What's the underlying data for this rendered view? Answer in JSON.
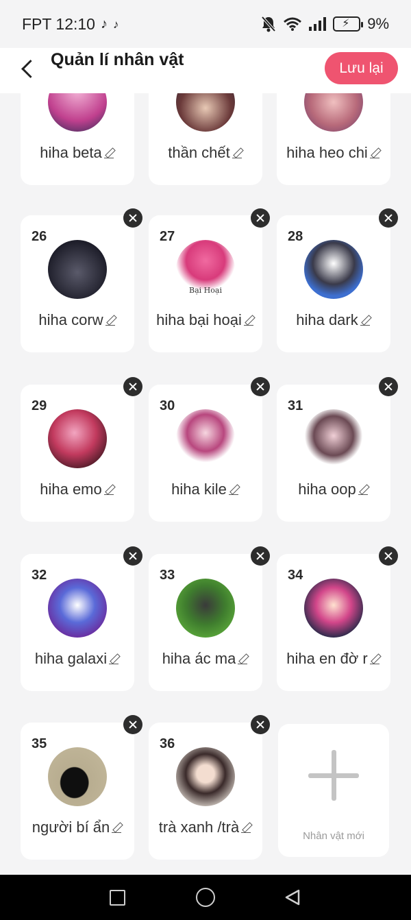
{
  "status_bar": {
    "carrier_time": "FPT 12:10",
    "battery": "9%",
    "icons": [
      "tiktok-icon",
      "tiktok-icon",
      "mute-bell-icon",
      "wifi-icon",
      "signal-icon",
      "battery-charging-icon"
    ]
  },
  "header": {
    "title": "Quản lí nhân vật",
    "save_label": "Lưu lại",
    "save_color": "#ef5470"
  },
  "characters_top_row": [
    {
      "name": "hiha beta"
    },
    {
      "name": "thần chết"
    },
    {
      "name": "hiha heo chi"
    }
  ],
  "characters": [
    {
      "number": "26",
      "name": "hiha corw"
    },
    {
      "number": "27",
      "name": "hiha bại hoại",
      "avatar_caption": "Bại Hoại"
    },
    {
      "number": "28",
      "name": "hiha dark"
    },
    {
      "number": "29",
      "name": "hiha emo"
    },
    {
      "number": "30",
      "name": "hiha kile"
    },
    {
      "number": "31",
      "name": "hiha oop"
    },
    {
      "number": "32",
      "name": "hiha galaxi"
    },
    {
      "number": "33",
      "name": "hiha ác ma"
    },
    {
      "number": "34",
      "name": "hiha en đờ r"
    },
    {
      "number": "35",
      "name": "người bí ẩn"
    },
    {
      "number": "36",
      "name": "trà xanh /trà"
    }
  ],
  "new_character": {
    "label": "Nhân vật mới"
  }
}
